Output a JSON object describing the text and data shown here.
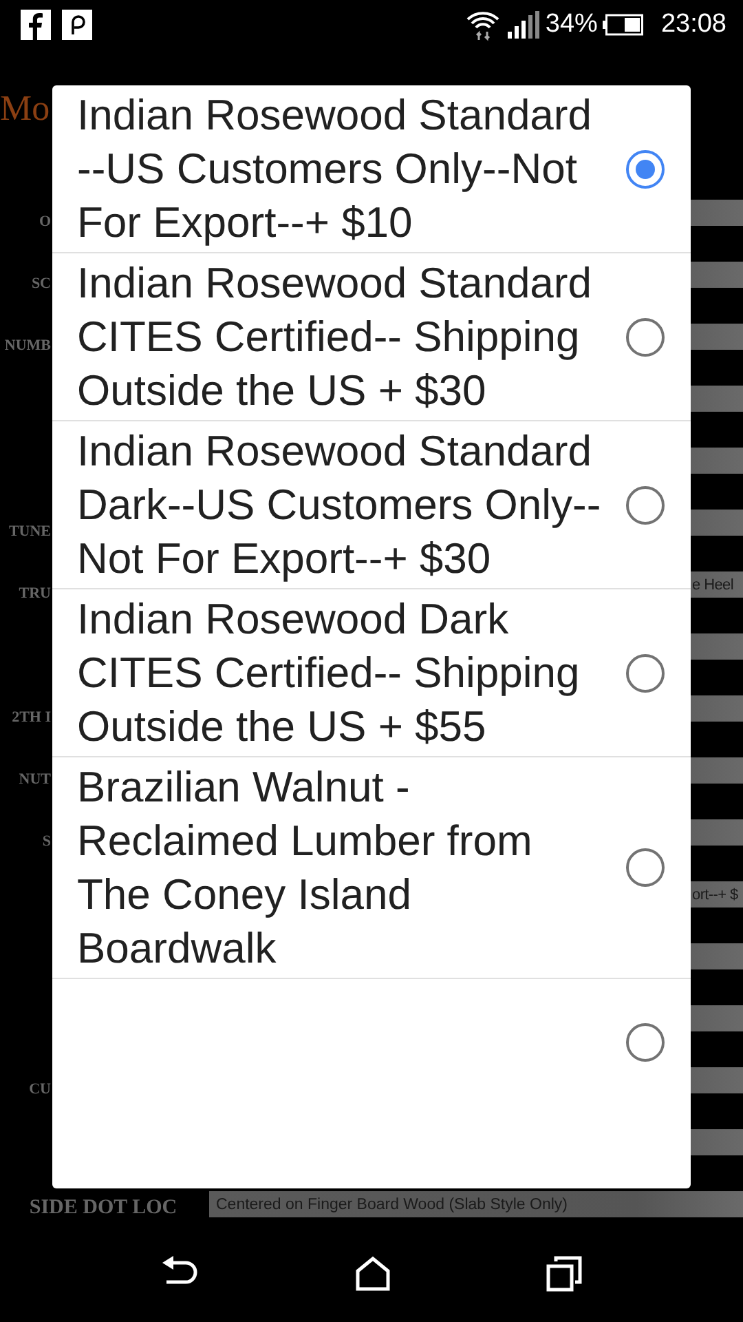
{
  "status_bar": {
    "battery": "34%",
    "time": "23:08"
  },
  "heading": {
    "link": "Mo"
  },
  "form": {
    "rows": [
      {
        "label": "O"
      },
      {
        "label": "SC"
      },
      {
        "label": "NUMB"
      },
      {},
      {},
      {
        "label": "TUNE"
      },
      {
        "label": "TRU",
        "value": "e Heel"
      },
      {},
      {
        "label": "2TH I"
      },
      {
        "label": "NUT"
      },
      {
        "label": "S"
      },
      {
        "value": "ort--+ $"
      },
      {},
      {},
      {
        "label": "CU"
      },
      {},
      {
        "label": "SIDE DOT LOC",
        "value": "Centered on Finger Board Wood (Slab Style Only)"
      }
    ]
  },
  "dialog": {
    "options": [
      {
        "label": "Indian Rosewood Standard --US Customers Only--Not For Export--+ $10",
        "selected": true
      },
      {
        "label": "Indian Rosewood Standard CITES Certified-- Shipping Outside the US + $30",
        "selected": false
      },
      {
        "label": "Indian Rosewood Standard Dark--US Customers Only--Not For Export--+ $30",
        "selected": false
      },
      {
        "label": "Indian Rosewood Dark CITES Certified-- Shipping Outside the US + $55",
        "selected": false
      },
      {
        "label": "Brazilian Walnut - Reclaimed Lumber from The Coney Island Boardwalk",
        "selected": false
      },
      {
        "selected": false
      }
    ]
  }
}
